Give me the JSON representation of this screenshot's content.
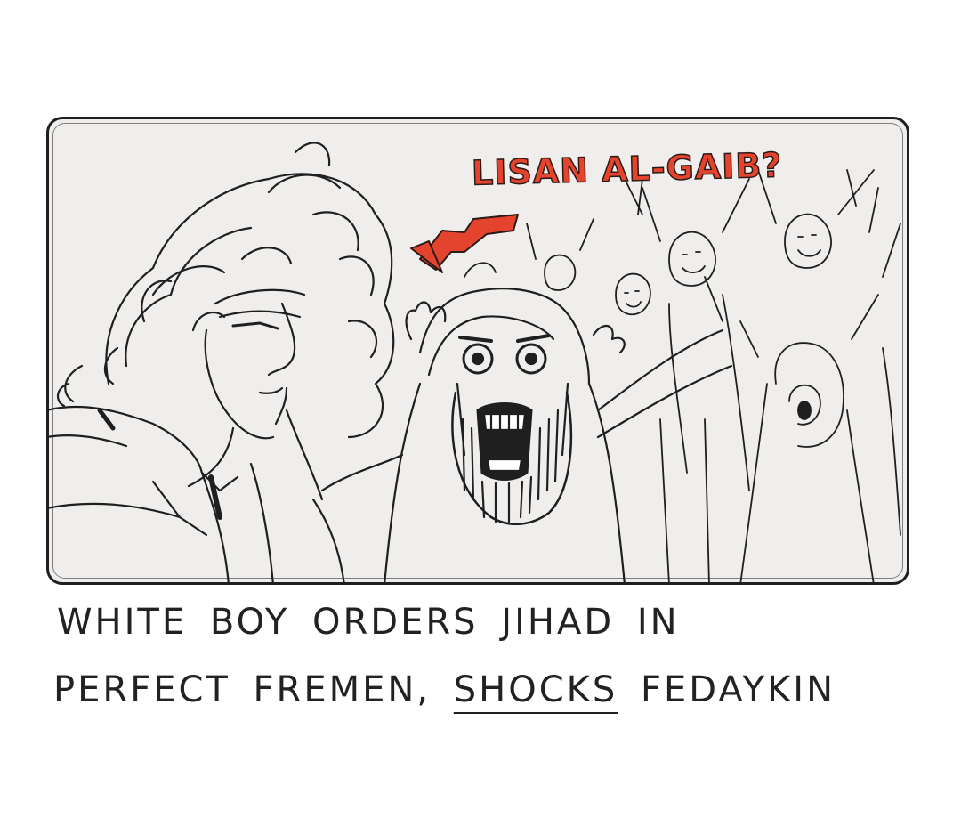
{
  "panel": {
    "shout_text": "LISAN AL-GAIB?",
    "shout_color": "#e4432d",
    "arrow_color": "#e4432d",
    "background_color": "#efeeec",
    "ink_color": "#1f1f1f"
  },
  "caption": {
    "line1": "WHITE BOY ORDERS JIHAD IN",
    "line2_before": "PERFECT FREMEN, ",
    "line2_underlined": "SHOCKS",
    "line2_after": " FEDAYKIN"
  },
  "icons": [
    "red-arrow-icon"
  ]
}
